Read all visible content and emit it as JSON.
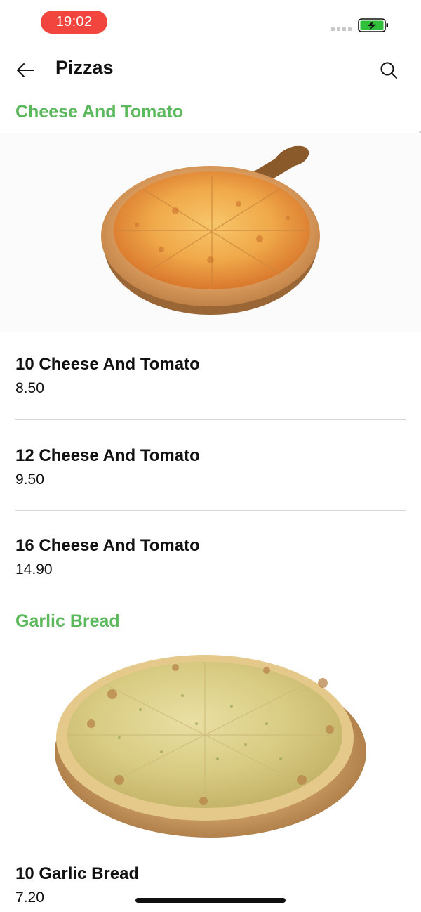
{
  "status_bar": {
    "time": "19:02",
    "battery_state": "charging",
    "battery_color": "#2fbf3b",
    "time_pill_color": "#f2453d"
  },
  "header": {
    "title": "Pizzas",
    "back_icon": "arrow-left-icon",
    "search_icon": "search-icon"
  },
  "accent_color": "#5cb85c",
  "sections": [
    {
      "title": "Cheese And Tomato",
      "image": "cheese-and-tomato-pizza-image",
      "items": [
        {
          "name": "10 Cheese And Tomato",
          "price": "8.50"
        },
        {
          "name": "12 Cheese And Tomato",
          "price": "9.50"
        },
        {
          "name": "16 Cheese And Tomato",
          "price": "14.90"
        }
      ]
    },
    {
      "title": "Garlic Bread",
      "image": "garlic-bread-pizza-image",
      "items": [
        {
          "name": "10 Garlic Bread",
          "price": "7.20"
        }
      ]
    }
  ]
}
